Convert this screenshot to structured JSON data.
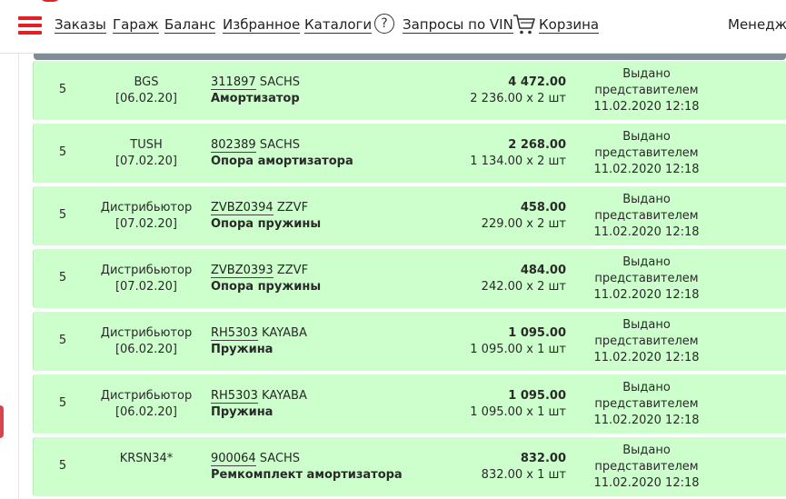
{
  "nav": {
    "items": [
      "Заказы",
      "Гараж",
      "Баланс",
      "Избранное",
      "Каталоги"
    ],
    "vin_label": "Запросы по VIN",
    "cart_label": "Корзина",
    "manager_label": "Менедж"
  },
  "colors": {
    "brand_red": "#e31e24",
    "row_green": "#ccffcc",
    "header_strip": "#7d8e99"
  },
  "icons": [
    "menu-icon",
    "question-icon",
    "cart-icon"
  ],
  "orders": [
    {
      "qty": "5",
      "supplier": "BGS",
      "date": "[06.02.20]",
      "part_no": "311897",
      "brand": "SACHS",
      "name": "Амортизатор",
      "total": "4 472.00",
      "unit": "2 236.00 х 2 шт",
      "status1": "Выдано",
      "status2": "представителем",
      "status_date": "11.02.2020 12:18"
    },
    {
      "qty": "5",
      "supplier": "TUSH",
      "date": "[07.02.20]",
      "part_no": "802389",
      "brand": "SACHS",
      "name": "Опора амортизатора",
      "total": "2 268.00",
      "unit": "1 134.00 х 2 шт",
      "status1": "Выдано",
      "status2": "представителем",
      "status_date": "11.02.2020 12:18"
    },
    {
      "qty": "5",
      "supplier": "Дистрибьютор",
      "date": "[07.02.20]",
      "part_no": "ZVBZ0394",
      "brand": "ZZVF",
      "name": "Опора пружины",
      "total": "458.00",
      "unit": "229.00 х 2 шт",
      "status1": "Выдано",
      "status2": "представителем",
      "status_date": "11.02.2020 12:18"
    },
    {
      "qty": "5",
      "supplier": "Дистрибьютор",
      "date": "[07.02.20]",
      "part_no": "ZVBZ0393",
      "brand": "ZZVF",
      "name": "Опора пружины",
      "total": "484.00",
      "unit": "242.00 х 2 шт",
      "status1": "Выдано",
      "status2": "представителем",
      "status_date": "11.02.2020 12:18"
    },
    {
      "qty": "5",
      "supplier": "Дистрибьютор",
      "date": "[06.02.20]",
      "part_no": "RH5303",
      "brand": "KAYABA",
      "name": "Пружина",
      "total": "1 095.00",
      "unit": "1 095.00 х 1 шт",
      "status1": "Выдано",
      "status2": "представителем",
      "status_date": "11.02.2020 12:18"
    },
    {
      "qty": "5",
      "supplier": "Дистрибьютор",
      "date": "[06.02.20]",
      "part_no": "RH5303",
      "brand": "KAYABA",
      "name": "Пружина",
      "total": "1 095.00",
      "unit": "1 095.00 х 1 шт",
      "status1": "Выдано",
      "status2": "представителем",
      "status_date": "11.02.2020 12:18"
    },
    {
      "qty": "5",
      "supplier": "KRSN34*",
      "date": "",
      "part_no": "900064",
      "brand": "SACHS",
      "name": "Ремкомплект амортизатора",
      "total": "832.00",
      "unit": "832.00 х 1 шт",
      "status1": "Выдано",
      "status2": "представителем",
      "status_date": "11.02.2020 12:18"
    }
  ]
}
